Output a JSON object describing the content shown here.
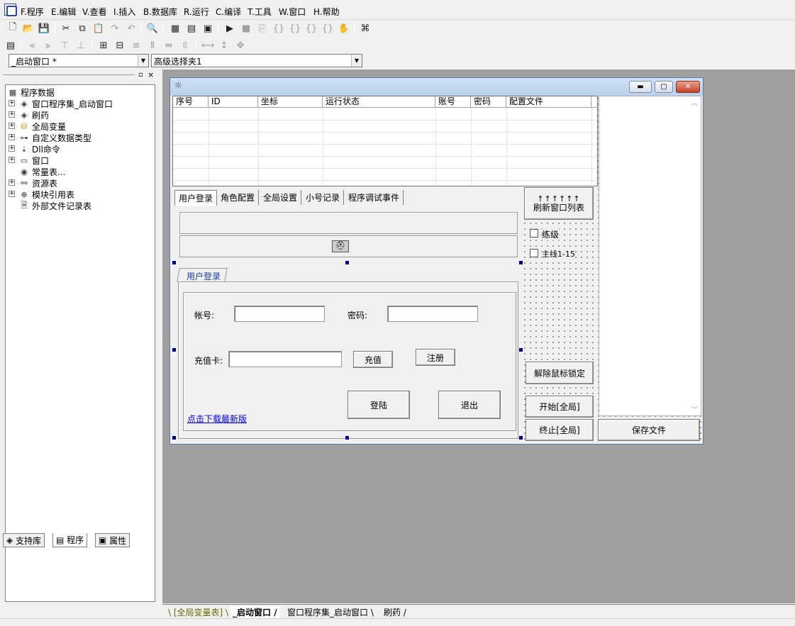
{
  "menu": [
    "F.程序",
    "E.编辑",
    "V.查看",
    "I.插入",
    "B.数据库",
    "R.运行",
    "C.编译",
    "T.工具",
    "W.窗口",
    "H.帮助"
  ],
  "combos": {
    "window_select": "_启动窗口 *",
    "control_select": "高级选择夹1"
  },
  "tree": {
    "root": "程序数据",
    "items": [
      "窗口程序集_启动窗口",
      "刷药",
      "全局变量",
      "自定义数据类型",
      "Dll命令",
      "窗口",
      "常量表...",
      "资源表",
      "模块引用表",
      "外部文件记录表"
    ]
  },
  "left_tabs": [
    "支持库",
    "程序",
    "属性"
  ],
  "grid": {
    "columns": [
      "序号",
      "ID",
      "坐标",
      "运行状态",
      "账号",
      "密码",
      "配置文件"
    ]
  },
  "tabs": [
    "用户登录",
    "角色配置",
    "全局设置",
    "小号记录",
    "程序调试事件"
  ],
  "login": {
    "group_title": "用户登录",
    "account_label": "帐号:",
    "password_label": "密码:",
    "card_label": "充值卡:",
    "recharge_button": "充值",
    "register_button": "注册",
    "login_button": "登陆",
    "exit_button": "退出",
    "download_link": "点击下载最新版"
  },
  "right_controls": {
    "refresh_arrows": "↑↑↑↑↑↑",
    "refresh_button": "刷新窗口列表",
    "check1": "练级",
    "check2": "主线1-15",
    "unlock_button": "解除鼠标锁定",
    "start_button": "开始[全局]",
    "stop_button": "终止[全局]",
    "save_button": "保存文件"
  },
  "editor_tabs": [
    "[全局变量表]",
    "_启动窗口",
    "窗口程序集_启动窗口",
    "刷药"
  ],
  "colors": {
    "workspace": "#a0a0a0",
    "link": "#0000ee",
    "accent": "#2a48a8"
  }
}
